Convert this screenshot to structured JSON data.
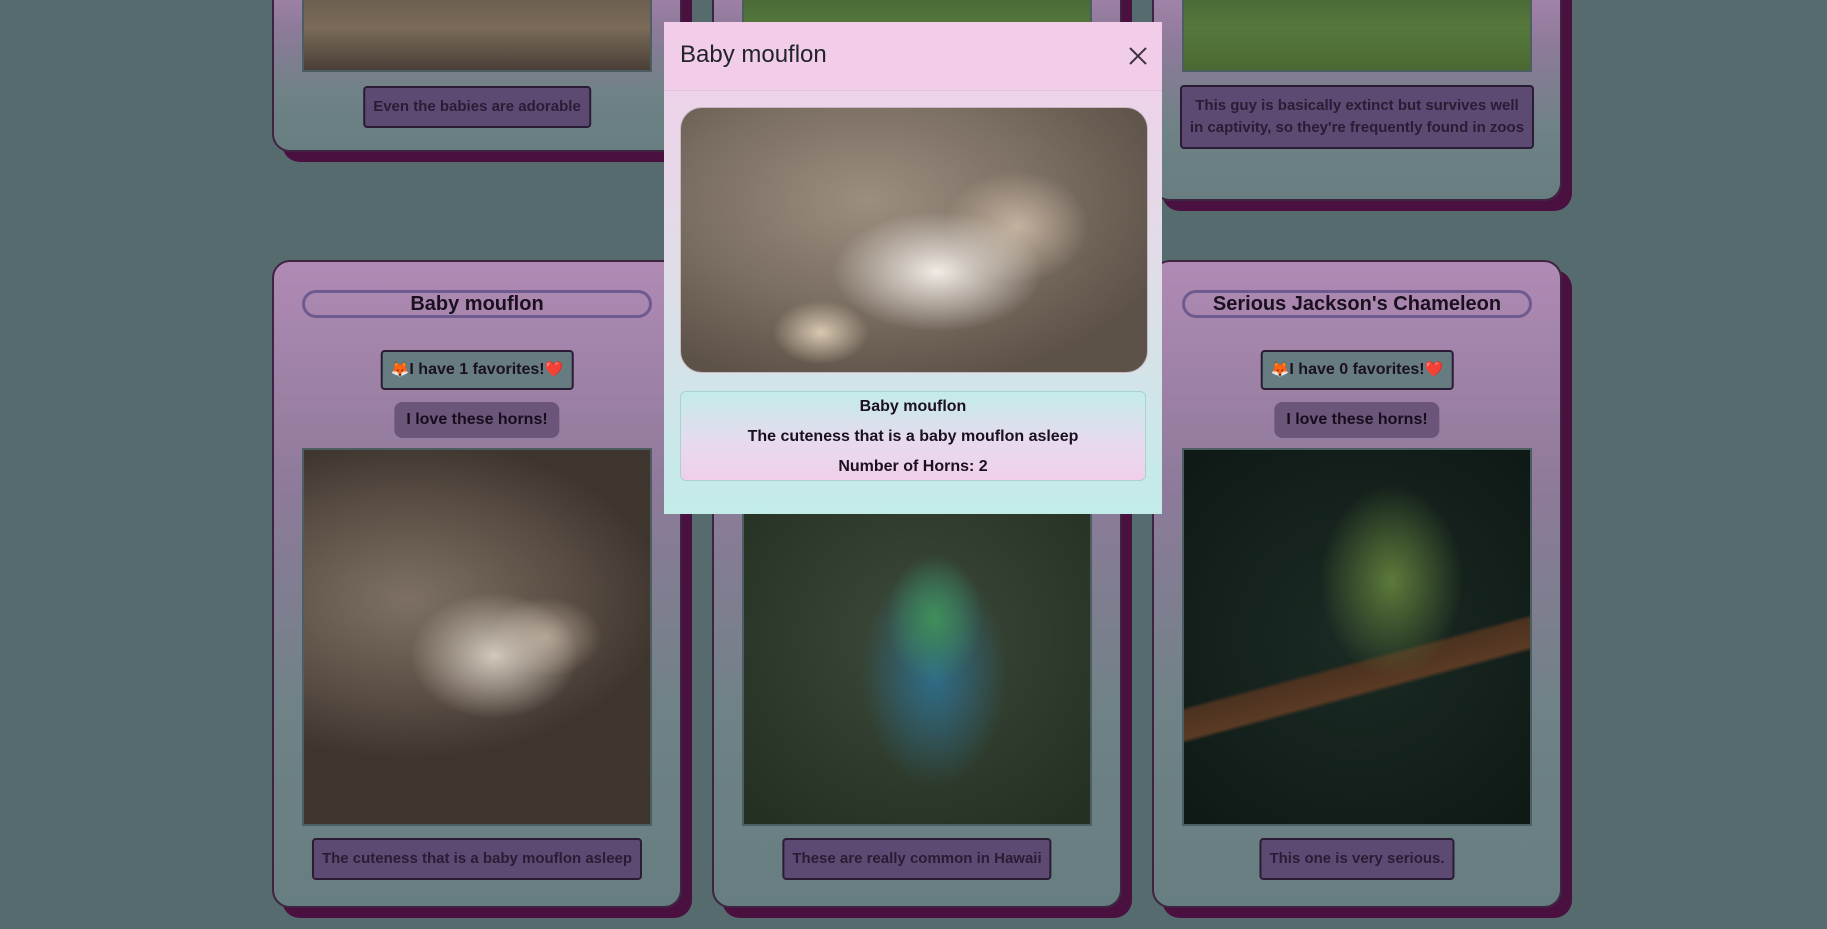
{
  "cards": {
    "top_left": {
      "description": "Even the babies are adorable"
    },
    "top_right": {
      "description": "This guy is basically extinct but survives well in captivity, so they're frequently found in zoos"
    },
    "left": {
      "title": "Baby mouflon",
      "favorites": "I have 1 favorites!",
      "love_label": "I love these horns!",
      "description": "The cuteness that is a baby mouflon asleep"
    },
    "middle": {
      "description": "These are really common in Hawaii"
    },
    "right": {
      "title": "Serious Jackson's Chameleon",
      "favorites": "I have 0 favorites!",
      "love_label": "I love these horns!",
      "description": "This one is very serious."
    }
  },
  "modal": {
    "title": "Baby mouflon",
    "info_title": "Baby mouflon",
    "info_description": "The cuteness that is a baby mouflon asleep",
    "info_horns": "Number of Horns: 2"
  },
  "icons": {
    "fox": "🦊",
    "heart": "❤️"
  },
  "colors": {
    "page_background": "#566b6e",
    "card_shadow": "#4a1040",
    "modal_header": "#f1cde9",
    "modal_bottom": "#c3ece9"
  }
}
